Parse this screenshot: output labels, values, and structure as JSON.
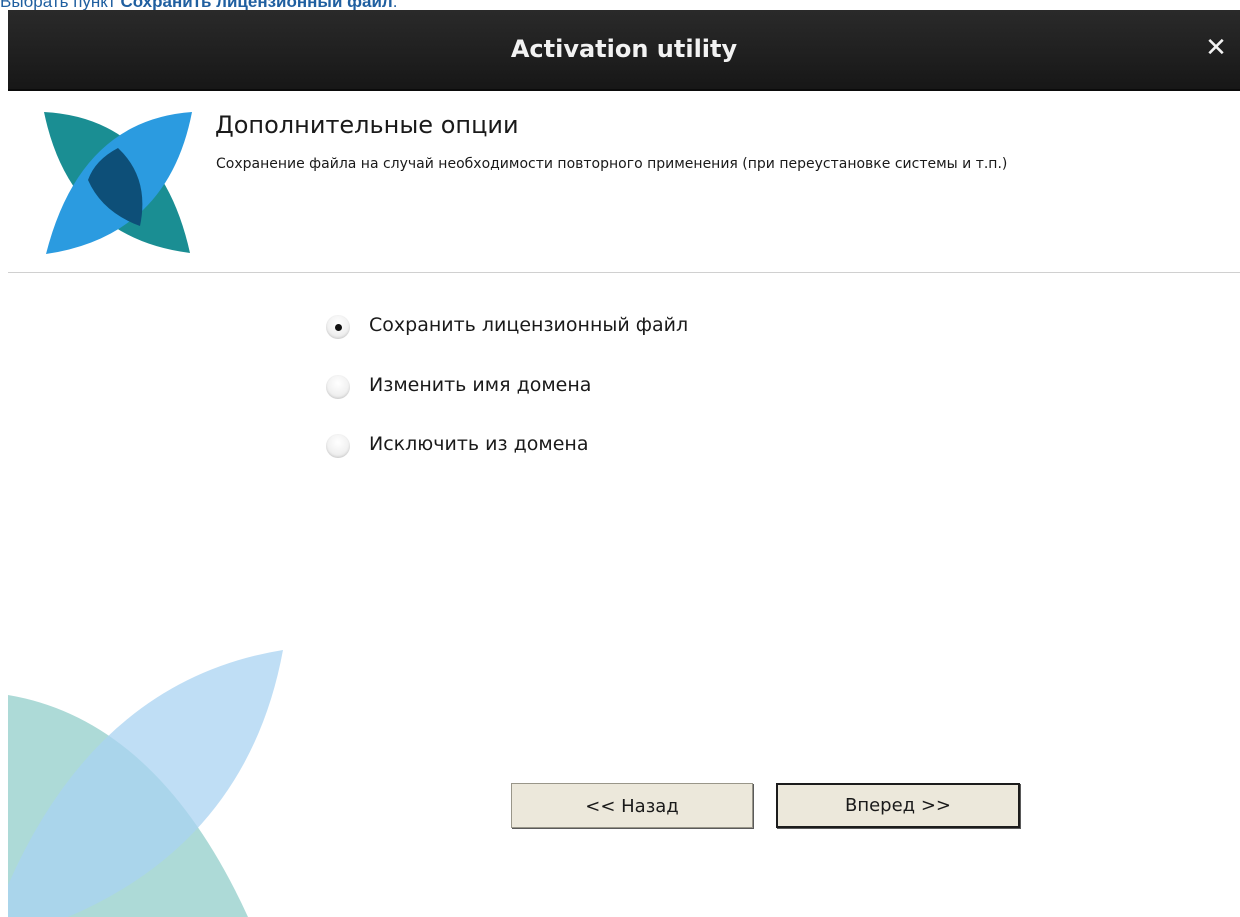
{
  "caption": {
    "prefix": "Выбрать пункт ",
    "bold": "Сохранить лицензионный файл",
    "suffix": "."
  },
  "window": {
    "title": "Activation utility",
    "close_symbol": "✕"
  },
  "header": {
    "title": "Дополнительные опции",
    "description": "Сохранение файла на случай необходимости повторного применения (при переустановке системы и т.п.)"
  },
  "options": [
    {
      "label": "Сохранить лицензионный файл",
      "checked": true
    },
    {
      "label": "Изменить имя домена",
      "checked": false
    },
    {
      "label": "Исключить из домена",
      "checked": false
    }
  ],
  "buttons": {
    "back": "<< Назад",
    "next": "Вперед >>"
  },
  "colors": {
    "logo_teal": "#1a8e93",
    "logo_blue": "#2b9be0",
    "logo_dark": "#0d4f78",
    "titlebar": "#1e1e1e",
    "button_bg": "#ece8db"
  }
}
